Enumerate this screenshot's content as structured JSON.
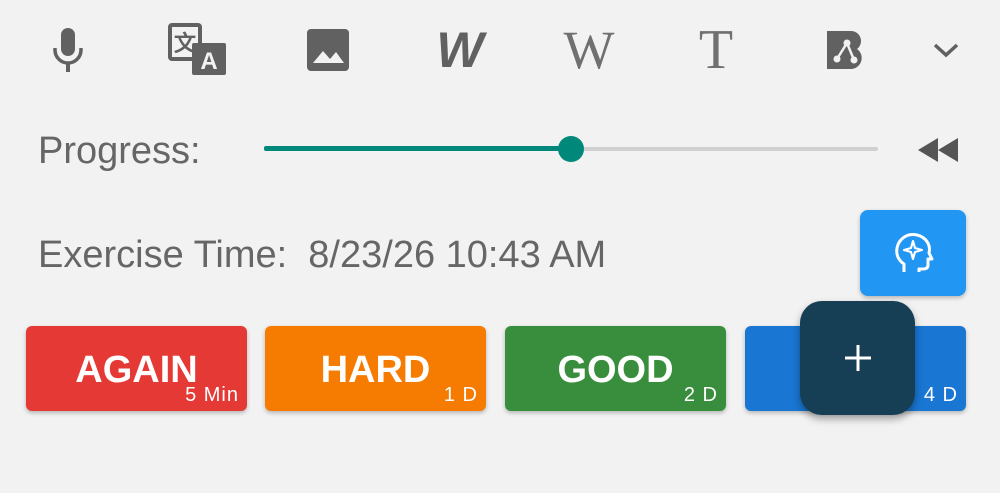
{
  "toolbar": {
    "icons": [
      "microphone-icon",
      "translate-icon",
      "image-icon",
      "bold-w-icon",
      "wikipedia-icon",
      "serif-t-icon",
      "node-b-icon",
      "chevron-down-icon"
    ],
    "wikipedia_glyph": "W",
    "bold_w_glyph": "W",
    "serif_t_glyph": "T"
  },
  "progress": {
    "label": "Progress:",
    "value": 0.5,
    "accent": "#00897b"
  },
  "exercise": {
    "label": "Exercise Time:",
    "time": "8/23/26 10:43 AM"
  },
  "answers": [
    {
      "label": "AGAIN",
      "interval": "5 Min",
      "color": "#e53935"
    },
    {
      "label": "HARD",
      "interval": "1 D",
      "color": "#f57c00"
    },
    {
      "label": "GOOD",
      "interval": "2 D",
      "color": "#388e3c"
    },
    {
      "label": "",
      "interval": "4 D",
      "color": "#1976d2"
    }
  ],
  "fab": {
    "glyph": "+"
  }
}
